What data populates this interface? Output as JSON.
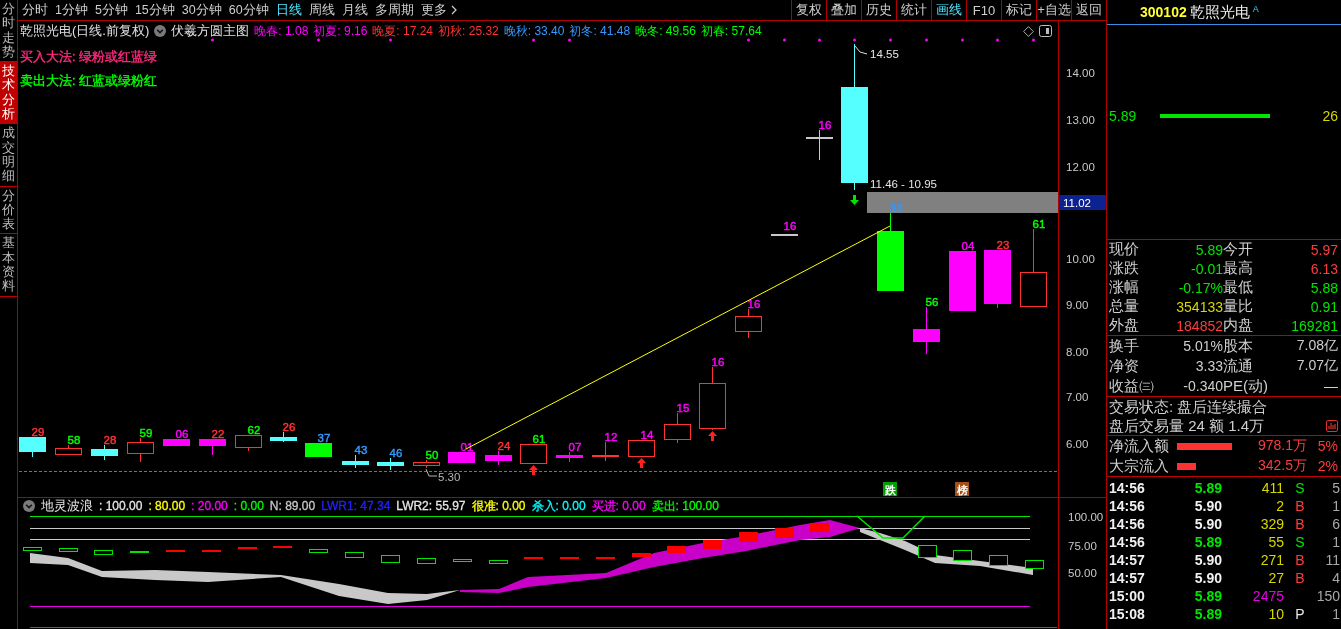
{
  "side_tabs": [
    {
      "label": "分时走势",
      "selected": false
    },
    {
      "label": "技术分析",
      "selected": true
    },
    {
      "label": "成交明细",
      "selected": false
    },
    {
      "label": "分价表",
      "selected": false
    },
    {
      "label": "基本资料",
      "selected": false
    }
  ],
  "period_tabs": [
    {
      "label": "分时",
      "selected": false
    },
    {
      "label": "1分钟",
      "selected": false
    },
    {
      "label": "5分钟",
      "selected": false
    },
    {
      "label": "15分钟",
      "selected": false
    },
    {
      "label": "30分钟",
      "selected": false
    },
    {
      "label": "60分钟",
      "selected": false
    },
    {
      "label": "日线",
      "selected": true
    },
    {
      "label": "周线",
      "selected": false
    },
    {
      "label": "月线",
      "selected": false
    },
    {
      "label": "多周期",
      "selected": false
    },
    {
      "label": "更多",
      "selected": false
    }
  ],
  "toolbar_buttons": [
    {
      "label": "复权",
      "selected": false
    },
    {
      "label": "叠加",
      "selected": false
    },
    {
      "label": "历史",
      "selected": false
    },
    {
      "label": "统计",
      "selected": false
    },
    {
      "label": "画线",
      "selected": true
    },
    {
      "label": "F10",
      "selected": false
    },
    {
      "label": "标记",
      "selected": false
    },
    {
      "label": "+自选",
      "selected": false
    },
    {
      "label": "返回",
      "selected": false
    }
  ],
  "main_chart": {
    "title": "乾照光电(日线.前复权)",
    "indicator": "伏羲方圆主图",
    "legend": [
      {
        "text": "晚春: 1.08",
        "color": "#ff00ff"
      },
      {
        "text": "初夏: 9.16",
        "color": "#ff00ff"
      },
      {
        "text": "晚夏: 17.24",
        "color": "#ff3232"
      },
      {
        "text": "初秋: 25.32",
        "color": "#ff3232"
      },
      {
        "text": "晚秋: 33.40",
        "color": "#3399ff"
      },
      {
        "text": "初冬: 41.48",
        "color": "#3399ff"
      },
      {
        "text": "晚冬: 49.56",
        "color": "#00ff00"
      },
      {
        "text": "初春: 57.64",
        "color": "#00ff00"
      }
    ],
    "notes": [
      {
        "text": "买入大法: 绿粉或红蓝绿",
        "color": "#ff2a7f"
      },
      {
        "text": "卖出大法: 红蓝或绿粉红",
        "color": "#00ff00"
      }
    ],
    "price_ticks": [
      "14.00",
      "13.00",
      "12.00",
      "10.00",
      "9.00",
      "8.00",
      "7.00",
      "6.00"
    ],
    "price_tag": "11.02",
    "high_label": "14.55",
    "range_label": "11.46 - 10.95",
    "low_label": "5.30",
    "candles": [
      {
        "kind": "filled",
        "color": "#55ffff",
        "label": {
          "text": "29",
          "color": "#ff3232"
        },
        "buy_signal": false,
        "sell_signal": false,
        "marked": false
      },
      {
        "kind": "hollow",
        "color": "#ff3232",
        "label": {
          "text": "58",
          "color": "#00ff00"
        },
        "buy_signal": false,
        "sell_signal": false,
        "marked": false
      },
      {
        "kind": "filled",
        "color": "#55ffff",
        "label": {
          "text": "28",
          "color": "#ff3232"
        },
        "buy_signal": false,
        "sell_signal": false,
        "marked": false
      },
      {
        "kind": "hollow",
        "color": "#ff3232",
        "label": {
          "text": "59",
          "color": "#00ff00"
        },
        "buy_signal": false,
        "sell_signal": false,
        "marked": false
      },
      {
        "kind": "filled",
        "color": "#ff00ff",
        "label": {
          "text": "06",
          "color": "#ff00ff"
        },
        "buy_signal": false,
        "sell_signal": false,
        "marked": false
      },
      {
        "kind": "filled",
        "color": "#ff00ff",
        "label": {
          "text": "22",
          "color": "#ff3232"
        },
        "buy_signal": false,
        "sell_signal": false,
        "marked": true
      },
      {
        "kind": "hollow",
        "color": "#ff3232",
        "label": {
          "text": "62",
          "color": "#00ff00"
        },
        "buy_signal": false,
        "sell_signal": false,
        "marked": false
      },
      {
        "kind": "filled",
        "color": "#55ffff",
        "label": {
          "text": "26",
          "color": "#ff3232"
        },
        "buy_signal": false,
        "sell_signal": false,
        "marked": false
      },
      {
        "kind": "filled",
        "color": "#00ff00",
        "label": {
          "text": "37",
          "color": "#3399ff"
        },
        "buy_signal": false,
        "sell_signal": false,
        "marked": true
      },
      {
        "kind": "filled",
        "color": "#55ffff",
        "label": {
          "text": "43",
          "color": "#3399ff"
        },
        "buy_signal": false,
        "sell_signal": false,
        "marked": false
      },
      {
        "kind": "filled",
        "color": "#55ffff",
        "label": {
          "text": "46",
          "color": "#3399ff"
        },
        "buy_signal": false,
        "sell_signal": false,
        "marked": true
      },
      {
        "kind": "hollow",
        "color": "#ff3232",
        "label": {
          "text": "50",
          "color": "#00ff00"
        },
        "buy_signal": false,
        "sell_signal": false,
        "marked": false
      },
      {
        "kind": "filled",
        "color": "#ff00ff",
        "label": {
          "text": "01",
          "color": "#ff00ff"
        },
        "buy_signal": false,
        "sell_signal": false,
        "marked": false
      },
      {
        "kind": "filled",
        "color": "#ff00ff",
        "label": {
          "text": "24",
          "color": "#ff3232"
        },
        "buy_signal": false,
        "sell_signal": false,
        "marked": false
      },
      {
        "kind": "hollow",
        "color": "#ff3232",
        "label": {
          "text": "61",
          "color": "#00ff00"
        },
        "buy_signal": true,
        "sell_signal": false,
        "marked": true
      },
      {
        "kind": "filled",
        "color": "#ff00ff",
        "label": {
          "text": "07",
          "color": "#ff00ff"
        },
        "buy_signal": false,
        "sell_signal": false,
        "marked": true
      },
      {
        "kind": "flat",
        "color": "#ff3232",
        "label": {
          "text": "12",
          "color": "#ff00ff"
        },
        "buy_signal": false,
        "sell_signal": false,
        "marked": false
      },
      {
        "kind": "hollow",
        "color": "#ff3232",
        "label": {
          "text": "14",
          "color": "#ff00ff"
        },
        "buy_signal": true,
        "sell_signal": false,
        "marked": false
      },
      {
        "kind": "hollow",
        "color": "#ff3232",
        "label": {
          "text": "15",
          "color": "#ff00ff"
        },
        "buy_signal": false,
        "sell_signal": false,
        "marked": false
      },
      {
        "kind": "hollow",
        "color": "#ff3232",
        "label": {
          "text": "16",
          "color": "#ff00ff"
        },
        "buy_signal": true,
        "sell_signal": false,
        "marked": false
      },
      {
        "kind": "hollow",
        "color": "#ff3232",
        "label": {
          "text": "16",
          "color": "#ff00ff"
        },
        "buy_signal": false,
        "sell_signal": false,
        "marked": true
      },
      {
        "kind": "flat",
        "color": "#c8c8c8",
        "label": {
          "text": "16",
          "color": "#ff00ff"
        },
        "buy_signal": false,
        "sell_signal": false,
        "marked": true
      },
      {
        "kind": "flat",
        "color": "#c8c8c8",
        "label": {
          "text": "16",
          "color": "#ff00ff"
        },
        "buy_signal": false,
        "sell_signal": false,
        "marked": true
      },
      {
        "kind": "filled",
        "color": "#55ffff",
        "buy_signal": false,
        "sell_signal": true,
        "marked": true
      },
      {
        "kind": "filled",
        "color": "#00ff00",
        "label": {
          "text": "33",
          "color": "#3399ff"
        },
        "buy_signal": false,
        "sell_signal": false,
        "marked": true
      },
      {
        "kind": "filled",
        "color": "#ff00ff",
        "label": {
          "text": "56",
          "color": "#00ff00"
        },
        "buy_signal": false,
        "sell_signal": false,
        "marked": true
      },
      {
        "kind": "filled",
        "color": "#ff00ff",
        "label": {
          "text": "04",
          "color": "#ff00ff"
        },
        "buy_signal": false,
        "sell_signal": false,
        "marked": true
      },
      {
        "kind": "filled",
        "color": "#ff00ff",
        "label": {
          "text": "23",
          "color": "#ff3232"
        },
        "buy_signal": false,
        "sell_signal": false,
        "marked": true
      },
      {
        "kind": "hollow",
        "color": "#ff3232",
        "label": {
          "text": "61",
          "color": "#00ff00"
        },
        "buy_signal": false,
        "sell_signal": false,
        "marked": true
      }
    ],
    "badges": [
      {
        "text": "跌",
        "color": "#00a000"
      },
      {
        "text": "榜",
        "color": "#a84e10"
      }
    ]
  },
  "indicator": {
    "name": "地灵波浪",
    "readouts": [
      {
        "text": ": 100.00",
        "color": "#e6e6e6"
      },
      {
        "text": ": 80.00",
        "color": "#ffff00"
      },
      {
        "text": ": 20.00",
        "color": "#ff00ff"
      },
      {
        "text": ": 0.00",
        "color": "#00ff00"
      },
      {
        "text": "N: 89.00",
        "color": "#c8c8c8"
      },
      {
        "text": "LWR1: 47.34",
        "color": "#2222ff"
      },
      {
        "text": "LWR2: 55.97",
        "color": "#e6e6e6"
      },
      {
        "text": "很准: 0.00",
        "color": "#ffff00"
      },
      {
        "text": "杀入: 0.00",
        "color": "#00ffff"
      },
      {
        "text": "买进: 0.00",
        "color": "#ff00ff"
      },
      {
        "text": "卖出: 100.00",
        "color": "#00ff00"
      }
    ],
    "ticks": [
      "100.00",
      "75.00",
      "50.00"
    ]
  },
  "quote": {
    "code": "300102",
    "name": "乾照光电",
    "badge": "A",
    "book": [
      {
        "price": "5.89",
        "color": "#00e600",
        "volume": "26"
      }
    ],
    "stats_main": [
      {
        "label": "现价",
        "value": "5.89",
        "color": "#00e600"
      },
      {
        "label": "今开",
        "value": "5.97",
        "color": "#ff3c3c"
      },
      {
        "label": "涨跌",
        "value": "-0.01",
        "color": "#00e600"
      },
      {
        "label": "最高",
        "value": "6.13",
        "color": "#ff3c3c"
      },
      {
        "label": "涨幅",
        "value": "-0.17%",
        "color": "#00e600"
      },
      {
        "label": "最低",
        "value": "5.88",
        "color": "#00e600"
      },
      {
        "label": "总量",
        "value": "354133",
        "color": "#d7d700"
      },
      {
        "label": "量比",
        "value": "0.91",
        "color": "#00e600"
      },
      {
        "label": "外盘",
        "value": "184852",
        "color": "#ff3c3c"
      },
      {
        "label": "内盘",
        "value": "169281",
        "color": "#00e600"
      }
    ],
    "stats_finance": [
      {
        "label": "换手",
        "value": "5.01%"
      },
      {
        "label": "股本",
        "value": "7.08亿"
      },
      {
        "label": "净资",
        "value": "3.33"
      },
      {
        "label": "流通",
        "value": "7.07亿"
      },
      {
        "label": "收益㈢",
        "value": "-0.340"
      },
      {
        "label": "PE(动)",
        "value": "—"
      }
    ],
    "trade_status": "交易状态: 盘后连续撮合",
    "after_hours": "盘后交易量 24 额 1.4万",
    "flows": [
      {
        "label": "净流入额",
        "value": "978.1万",
        "percent": "5%"
      },
      {
        "label": "大宗流入",
        "value": "342.5万",
        "percent": "2%"
      }
    ],
    "ticks": [
      {
        "time": "14:56",
        "price": {
          "text": "5.89",
          "color": "#00e600"
        },
        "volume": "411",
        "large": false,
        "side": {
          "text": "S",
          "color": "#00e600"
        },
        "count": "5"
      },
      {
        "time": "14:56",
        "price": {
          "text": "5.90",
          "color": "#f2f2f2"
        },
        "volume": "2",
        "large": false,
        "side": {
          "text": "B",
          "color": "#ff3c3c"
        },
        "count": "1"
      },
      {
        "time": "14:56",
        "price": {
          "text": "5.90",
          "color": "#f2f2f2"
        },
        "volume": "329",
        "large": false,
        "side": {
          "text": "B",
          "color": "#ff3c3c"
        },
        "count": "6"
      },
      {
        "time": "14:56",
        "price": {
          "text": "5.89",
          "color": "#00e600"
        },
        "volume": "55",
        "large": false,
        "side": {
          "text": "S",
          "color": "#00e600"
        },
        "count": "1"
      },
      {
        "time": "14:57",
        "price": {
          "text": "5.90",
          "color": "#f2f2f2"
        },
        "volume": "271",
        "large": false,
        "side": {
          "text": "B",
          "color": "#ff3c3c"
        },
        "count": "11"
      },
      {
        "time": "14:57",
        "price": {
          "text": "5.90",
          "color": "#f2f2f2"
        },
        "volume": "27",
        "large": false,
        "side": {
          "text": "B",
          "color": "#ff3c3c"
        },
        "count": "4"
      },
      {
        "time": "15:00",
        "price": {
          "text": "5.89",
          "color": "#00e600"
        },
        "volume": "2475",
        "large": true,
        "count": "150"
      },
      {
        "time": "15:08",
        "price": {
          "text": "5.89",
          "color": "#00e600"
        },
        "volume": "10",
        "large": false,
        "side": {
          "text": "P",
          "color": "#e8e8e8"
        },
        "count": "1"
      }
    ]
  }
}
